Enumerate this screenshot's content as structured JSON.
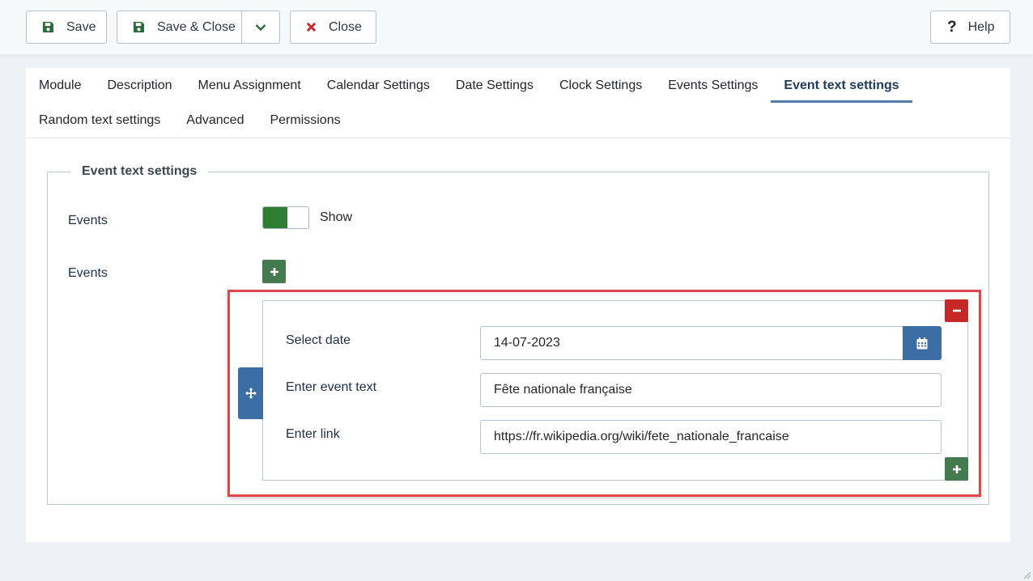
{
  "toolbar": {
    "save_label": "Save",
    "save_close_label": "Save & Close",
    "close_label": "Close",
    "help_label": "Help",
    "help_glyph": "?"
  },
  "tabs": {
    "row1": [
      "Module",
      "Description",
      "Menu Assignment",
      "Calendar Settings",
      "Date Settings",
      "Clock Settings",
      "Events Settings",
      "Event text settings"
    ],
    "row2": [
      "Random text settings",
      "Advanced",
      "Permissions"
    ],
    "active": "Event text settings"
  },
  "fieldset": {
    "legend": "Event text settings",
    "events_toggle": {
      "label": "Events",
      "state_text": "Show",
      "on": true
    },
    "events_list": {
      "label": "Events",
      "rows": [
        {
          "date_label": "Select date",
          "date_value": "14-07-2023",
          "text_label": "Enter event text",
          "text_value": "Fête nationale française",
          "link_label": "Enter link",
          "link_value": "https://fr.wikipedia.org/wiki/fete_nationale_francaise"
        }
      ]
    }
  },
  "colors": {
    "page_bg": "#eef2f6",
    "save_icon": "#2e6b3a",
    "close_icon": "#c62828",
    "toggle_on": "#2e7d32",
    "add_button": "#437a4e",
    "remove_button": "#c62828",
    "accent_blue": "#3c6ea5",
    "highlight_border": "#e0484d"
  },
  "icons": [
    "save-icon",
    "chevron-down-icon",
    "close-icon",
    "help-icon",
    "plus-icon",
    "minus-icon",
    "move-icon",
    "calendar-icon"
  ]
}
